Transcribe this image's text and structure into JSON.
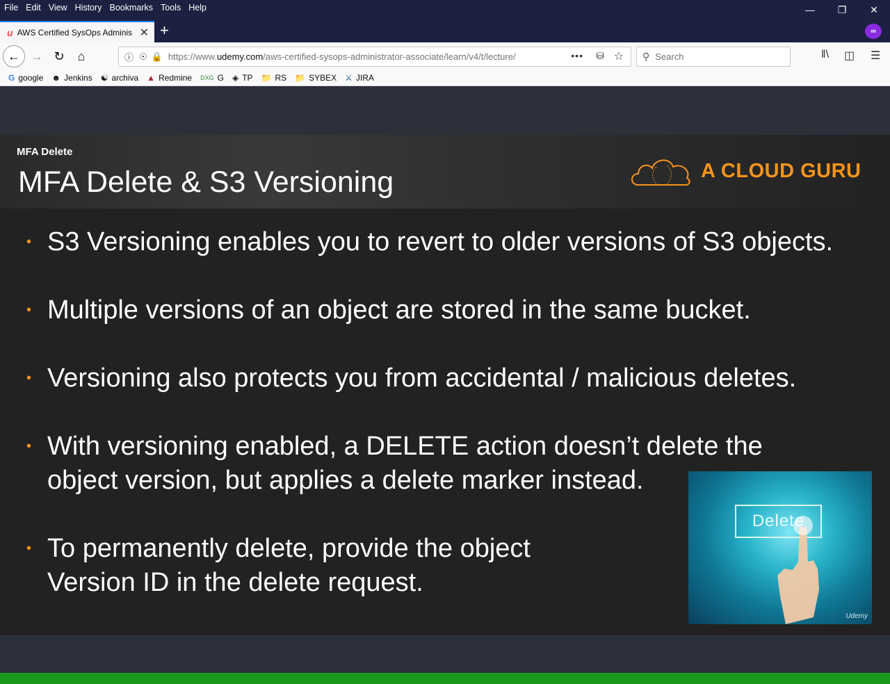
{
  "menubar": {
    "items": [
      "File",
      "Edit",
      "View",
      "History",
      "Bookmarks",
      "Tools",
      "Help"
    ]
  },
  "tab": {
    "title": "AWS Certified SysOps Administ",
    "favicon": "udemy-icon"
  },
  "navbar": {
    "url_prefix": "https://www.",
    "url_domain": "udemy.com",
    "url_path": "/aws-certified-sysops-administrator-associate/learn/v4/t/lecture/",
    "search_placeholder": "Search"
  },
  "bookmarks": [
    {
      "label": "google",
      "icon": "google-icon"
    },
    {
      "label": "Jenkins",
      "icon": "jenkins-icon"
    },
    {
      "label": "archiva",
      "icon": "globe-icon"
    },
    {
      "label": "Redmine",
      "icon": "redmine-icon"
    },
    {
      "label": "G",
      "icon": "dxg-icon"
    },
    {
      "label": "TP",
      "icon": "tp-icon"
    },
    {
      "label": "RS",
      "icon": "folder-icon"
    },
    {
      "label": "SYBEX",
      "icon": "folder-icon"
    },
    {
      "label": "JIRA",
      "icon": "jira-icon"
    }
  ],
  "slide": {
    "subtitle": "MFA Delete",
    "title": "MFA Delete & S3 Versioning",
    "logo_text": "A CLOUD GURU",
    "bullets": [
      {
        "lines": [
          "S3 Versioning enables you to revert to older versions of S3 objects."
        ]
      },
      {
        "lines": [
          "Multiple versions of an object are stored in the same bucket."
        ]
      },
      {
        "lines": [
          "Versioning also protects you from accidental / malicious deletes."
        ]
      },
      {
        "lines": [
          "With versioning enabled, a DELETE action doesn’t delete the",
          "object version, but applies a delete marker instead."
        ]
      },
      {
        "lines": [
          "To permanently delete, provide the object",
          "Version ID in the delete request."
        ]
      }
    ],
    "photo_button": "Delete",
    "watermark": "Udemy"
  },
  "colors": {
    "accent": "#f7941d",
    "progress": "#1a9a1a",
    "titlebar": "#1c2142"
  }
}
